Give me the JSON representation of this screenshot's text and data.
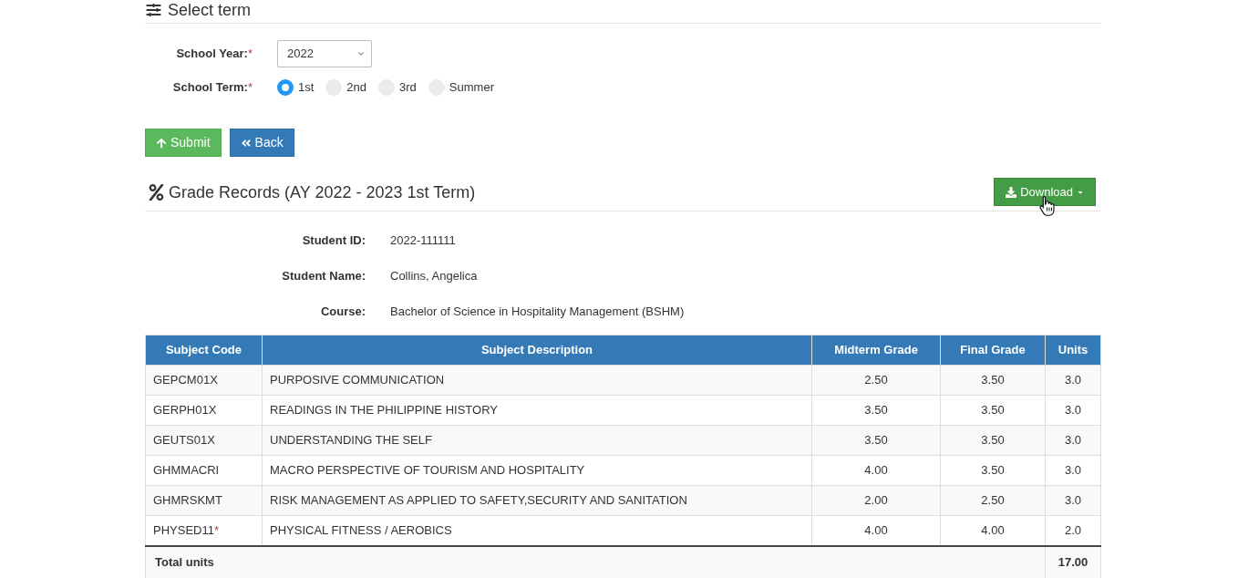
{
  "select_term": {
    "title": "Select term"
  },
  "form": {
    "school_year": {
      "label": "School Year:",
      "required_mark": "*",
      "value": "2022"
    },
    "school_term": {
      "label": "School Term:",
      "required_mark": "*",
      "options": [
        {
          "label": "1st",
          "selected": true
        },
        {
          "label": "2nd",
          "selected": false
        },
        {
          "label": "3rd",
          "selected": false
        },
        {
          "label": "Summer",
          "selected": false
        }
      ]
    }
  },
  "buttons": [
    {
      "kind": "submit",
      "label": "Submit"
    },
    {
      "kind": "back",
      "label": "Back"
    }
  ],
  "grade_records": {
    "title": "Grade Records (AY 2022 - 2023 1st Term)",
    "download_button": {
      "label": "Download"
    },
    "student_info": [
      {
        "label": "Student ID:",
        "value": "2022-111111"
      },
      {
        "label": "Student Name:",
        "value": "Collins, Angelica"
      },
      {
        "label": "Course:",
        "value": "Bachelor of Science in Hospitality Management (BSHM)"
      }
    ],
    "table": {
      "columns": [
        "Subject Code",
        "Subject Description",
        "Midterm Grade",
        "Final Grade",
        "Units"
      ],
      "rows": [
        {
          "code": "GEPCM01X",
          "description": "PURPOSIVE COMMUNICATION",
          "midterm": "2.50",
          "final": "3.50",
          "units": "3.0"
        },
        {
          "code": "GERPH01X",
          "description": "READINGS IN THE PHILIPPINE HISTORY",
          "midterm": "3.50",
          "final": "3.50",
          "units": "3.0"
        },
        {
          "code": "GEUTS01X",
          "description": "UNDERSTANDING THE SELF",
          "midterm": "3.50",
          "final": "3.50",
          "units": "3.0"
        },
        {
          "code": "GHMMACRI",
          "description": "MACRO PERSPECTIVE OF TOURISM AND HOSPITALITY",
          "midterm": "4.00",
          "final": "3.50",
          "units": "3.0"
        },
        {
          "code": "GHMRSKMT",
          "description": "RISK MANAGEMENT AS APPLIED TO SAFETY,SECURITY AND SANITATION",
          "midterm": "2.00",
          "final": "2.50",
          "units": "3.0"
        },
        {
          "code": "PHYSED11",
          "code_mark": "*",
          "description": "PHYSICAL FITNESS / AEROBICS",
          "midterm": "4.00",
          "final": "4.00",
          "units": "2.0"
        }
      ],
      "footer": {
        "label": "Total units",
        "total": "17.00"
      }
    }
  }
}
